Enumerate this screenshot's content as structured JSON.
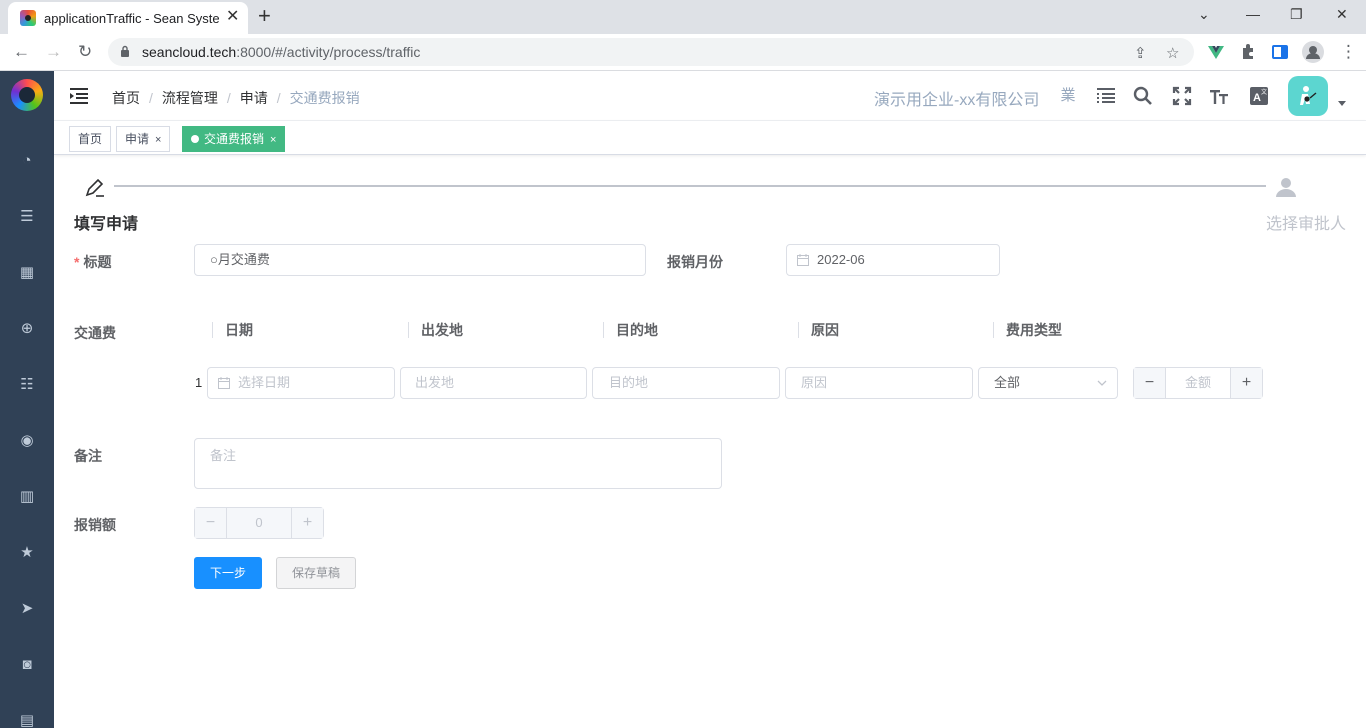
{
  "browser": {
    "tab_title": "applicationTraffic - Sean System",
    "url_host": "seancloud.tech",
    "url_rest": ":8000/#/activity/process/traffic"
  },
  "navbar": {
    "breadcrumbs": [
      "首页",
      "流程管理",
      "申请",
      "交通费报销"
    ],
    "company": "演示用企业-xx有限公司",
    "lang_char": "業"
  },
  "tags": [
    {
      "label": "首页"
    },
    {
      "label": "申请"
    },
    {
      "label": "交通费报销"
    }
  ],
  "steps": [
    {
      "title": "填写申请"
    },
    {
      "title": "选择审批人"
    }
  ],
  "form": {
    "title_label": "标题",
    "title_value": "○月交通费",
    "month_label": "报销月份",
    "month_value": "2022-06",
    "traffic_label": "交通费",
    "columns": [
      "日期",
      "出发地",
      "目的地",
      "原因",
      "费用类型"
    ],
    "row": {
      "index": "1",
      "date_placeholder": "选择日期",
      "from_placeholder": "出发地",
      "to_placeholder": "目的地",
      "reason_placeholder": "原因",
      "type_value": "全部",
      "amount_placeholder": "金额"
    },
    "remark_label": "备注",
    "remark_placeholder": "备注",
    "total_label": "报销额",
    "total_value": "0",
    "next_button": "下一步",
    "draft_button": "保存草稿"
  },
  "colors": {
    "sidebar": "#304156",
    "active_tag": "#42b983",
    "primary": "#1890ff"
  }
}
